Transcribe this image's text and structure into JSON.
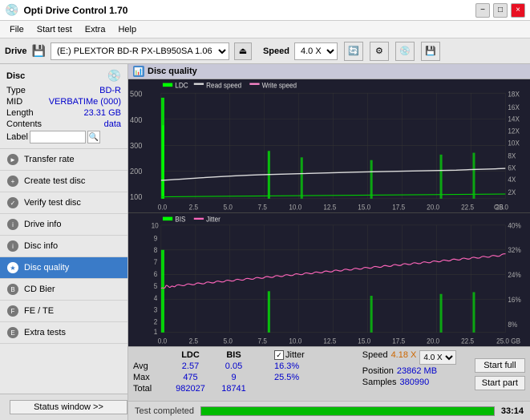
{
  "titlebar": {
    "title": "Opti Drive Control 1.70",
    "minimize": "−",
    "maximize": "□",
    "close": "×"
  },
  "menubar": {
    "items": [
      "File",
      "Start test",
      "Extra",
      "Help"
    ]
  },
  "drivebar": {
    "label": "Drive",
    "drive_value": "(E:) PLEXTOR BD-R  PX-LB950SA 1.06",
    "speed_label": "Speed",
    "speed_value": "4.0 X"
  },
  "disc": {
    "section_label": "Disc",
    "type_label": "Type",
    "type_value": "BD-R",
    "mid_label": "MID",
    "mid_value": "VERBATIMe (000)",
    "length_label": "Length",
    "length_value": "23.31 GB",
    "contents_label": "Contents",
    "contents_value": "data",
    "label_label": "Label",
    "label_value": ""
  },
  "nav": {
    "items": [
      {
        "id": "transfer-rate",
        "label": "Transfer rate",
        "active": false
      },
      {
        "id": "create-test-disc",
        "label": "Create test disc",
        "active": false
      },
      {
        "id": "verify-test-disc",
        "label": "Verify test disc",
        "active": false
      },
      {
        "id": "drive-info",
        "label": "Drive info",
        "active": false
      },
      {
        "id": "disc-info",
        "label": "Disc info",
        "active": false
      },
      {
        "id": "disc-quality",
        "label": "Disc quality",
        "active": true
      },
      {
        "id": "cd-bier",
        "label": "CD Bier",
        "active": false
      },
      {
        "id": "fe-te",
        "label": "FE / TE",
        "active": false
      },
      {
        "id": "extra-tests",
        "label": "Extra tests",
        "active": false
      }
    ]
  },
  "chart": {
    "title": "Disc quality",
    "legend_top": [
      "LDC",
      "Read speed",
      "Write speed"
    ],
    "legend_bottom": [
      "BIS",
      "Jitter"
    ],
    "x_labels": [
      "0.0",
      "2.5",
      "5.0",
      "7.5",
      "10.0",
      "12.5",
      "15.0",
      "17.5",
      "20.0",
      "22.5",
      "25.0"
    ],
    "y_left_top": [
      "500",
      "400",
      "300",
      "200",
      "100"
    ],
    "y_right_top": [
      "18X",
      "16X",
      "14X",
      "12X",
      "10X",
      "8X",
      "6X",
      "4X",
      "2X"
    ],
    "y_left_bottom": [
      "10",
      "9",
      "8",
      "7",
      "6",
      "5",
      "4",
      "3",
      "2",
      "1"
    ],
    "y_right_bottom": [
      "40%",
      "32%",
      "24%",
      "16%",
      "8%"
    ]
  },
  "stats": {
    "headers": [
      "",
      "LDC",
      "BIS",
      "",
      "Jitter",
      "Speed",
      ""
    ],
    "avg_label": "Avg",
    "avg_ldc": "2.57",
    "avg_bis": "0.05",
    "avg_jitter": "16.3%",
    "max_label": "Max",
    "max_ldc": "475",
    "max_bis": "9",
    "max_jitter": "25.5%",
    "total_label": "Total",
    "total_ldc": "982027",
    "total_bis": "18741",
    "speed_label": "Speed",
    "speed_value": "4.18 X",
    "speed_select": "4.0 X",
    "position_label": "Position",
    "position_value": "23862 MB",
    "samples_label": "Samples",
    "samples_value": "380990",
    "start_full_label": "Start full",
    "start_part_label": "Start part"
  },
  "statusbar": {
    "status_window_label": "Status window >>",
    "status_text": "Test completed",
    "progress": 100,
    "time": "33:14"
  }
}
